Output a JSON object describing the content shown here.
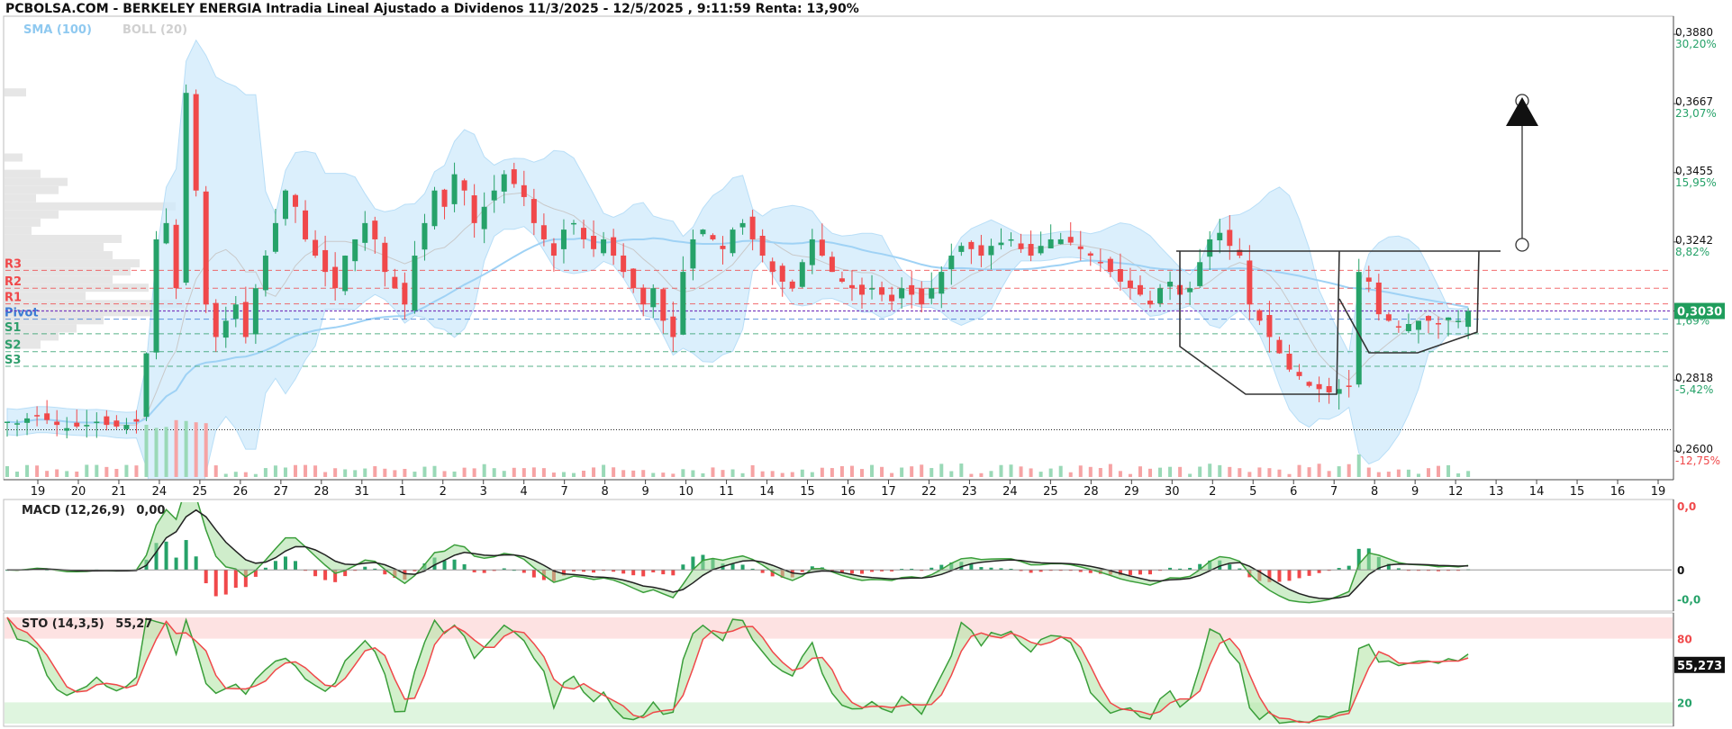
{
  "header": {
    "title": "PCBOLSA.COM - BERKELEY ENERGIA Intradia Lineal Ajustado a Dividenos 11/3/2025 - 12/5/2025 , 9:11:59 Renta: 13,90%",
    "sma_label": "SMA (100)",
    "boll_label": "BOLL (20)"
  },
  "colors": {
    "up": "#26a269",
    "down": "#f0484a",
    "sma": "#9fd2f5",
    "boll_fill": "#cfe9fb",
    "resistance": "#f0484a",
    "support": "#2e9e6b",
    "pivot": "#3a7bd5",
    "price_badge": "#1f9d5c"
  },
  "pivot_levels": [
    {
      "name": "R3",
      "value": 0.3155
    },
    {
      "name": "R2",
      "value": 0.31
    },
    {
      "name": "R1",
      "value": 0.3052
    },
    {
      "name": "Pivot",
      "value": 0.3005
    },
    {
      "name": "S1",
      "value": 0.296
    },
    {
      "name": "S2",
      "value": 0.2905
    },
    {
      "name": "S3",
      "value": 0.286
    }
  ],
  "chart_data": [
    {
      "type": "candlestick",
      "title": "PCBOLSA.COM - BERKELEY ENERGIA Intradia Lineal Ajustado a Dividenos 11/3/2025 - 12/5/2025 , 9:11:59 Renta: 13,90%",
      "ylim": [
        0.252,
        0.393
      ],
      "y_ticks": [
        {
          "value": 0.388,
          "label": "0,3880",
          "pct": "30,20%"
        },
        {
          "value": 0.3667,
          "label": "0,3667",
          "pct": "23,07%"
        },
        {
          "value": 0.3455,
          "label": "0,3455",
          "pct": "15,95%"
        },
        {
          "value": 0.3242,
          "label": "0,3242",
          "pct": "8,82%"
        },
        {
          "value": 0.303,
          "label": "0,3030",
          "pct": "1,69%"
        },
        {
          "value": 0.2818,
          "label": "0,2818",
          "pct": "-5,42%"
        },
        {
          "value": 0.26,
          "label": "0,2600",
          "pct": "-12,75%"
        }
      ],
      "x_labels": [
        "19",
        "20",
        "21",
        "24",
        "25",
        "26",
        "27",
        "28",
        "31",
        "1",
        "2",
        "3",
        "4",
        "7",
        "8",
        "9",
        "10",
        "11",
        "14",
        "15",
        "16",
        "17",
        "22",
        "23",
        "24",
        "25",
        "28",
        "29",
        "30",
        "2",
        "5",
        "6",
        "7",
        "8",
        "9",
        "12",
        "13",
        "14",
        "15",
        "16",
        "19"
      ],
      "last_price": "0,3030",
      "reference_price": 0.2665,
      "close_series": [
        0.269,
        0.2685,
        0.27,
        0.271,
        0.2695,
        0.268,
        0.267,
        0.2675,
        0.268,
        0.269,
        0.268,
        0.2675,
        0.268,
        0.269,
        0.29,
        0.325,
        0.33,
        0.31,
        0.37,
        0.34,
        0.305,
        0.295,
        0.3,
        0.305,
        0.295,
        0.31,
        0.32,
        0.33,
        0.34,
        0.335,
        0.325,
        0.32,
        0.315,
        0.31,
        0.32,
        0.325,
        0.33,
        0.325,
        0.315,
        0.31,
        0.305,
        0.32,
        0.33,
        0.34,
        0.335,
        0.345,
        0.34,
        0.33,
        0.335,
        0.34,
        0.345,
        0.342,
        0.338,
        0.33,
        0.325,
        0.32,
        0.328,
        0.33,
        0.325,
        0.322,
        0.325,
        0.32,
        0.315,
        0.31,
        0.305,
        0.31,
        0.3,
        0.295,
        0.315,
        0.325,
        0.328,
        0.325,
        0.322,
        0.328,
        0.33,
        0.325,
        0.32,
        0.315,
        0.312,
        0.31,
        0.318,
        0.325,
        0.32,
        0.315,
        0.312,
        0.31,
        0.308,
        0.31,
        0.308,
        0.306,
        0.31,
        0.308,
        0.305,
        0.31,
        0.315,
        0.32,
        0.323,
        0.322,
        0.32,
        0.323,
        0.324,
        0.325,
        0.322,
        0.32,
        0.323,
        0.325,
        0.325,
        0.324,
        0.322,
        0.32,
        0.318,
        0.315,
        0.312,
        0.31,
        0.308,
        0.305,
        0.31,
        0.312,
        0.308,
        0.31,
        0.318,
        0.325,
        0.327,
        0.323,
        0.32,
        0.305,
        0.3,
        0.295,
        0.29,
        0.285,
        0.283,
        0.28,
        0.279,
        0.278,
        0.279,
        0.28,
        0.315,
        0.312,
        0.302,
        0.3,
        0.298,
        0.299,
        0.3,
        0.3,
        0.299,
        0.301,
        0.3,
        0.303
      ]
    },
    {
      "type": "line",
      "title": "MACD (12,26,9)",
      "value_label": "0,00",
      "ylim": [
        -0.012,
        0.022
      ],
      "y_ticks": [
        {
          "value": 0.022,
          "label": "0,0"
        },
        {
          "value": 0.0,
          "label": "0"
        },
        {
          "value": -0.01,
          "label": "-0,0"
        }
      ]
    },
    {
      "type": "line",
      "title": "STO (14,3,5)",
      "value_label": "55,27",
      "last_value": "55,273",
      "ylim": [
        0,
        100
      ],
      "y_ticks": [
        {
          "value": 80,
          "label": "80"
        },
        {
          "value": 20,
          "label": "20"
        }
      ]
    }
  ]
}
